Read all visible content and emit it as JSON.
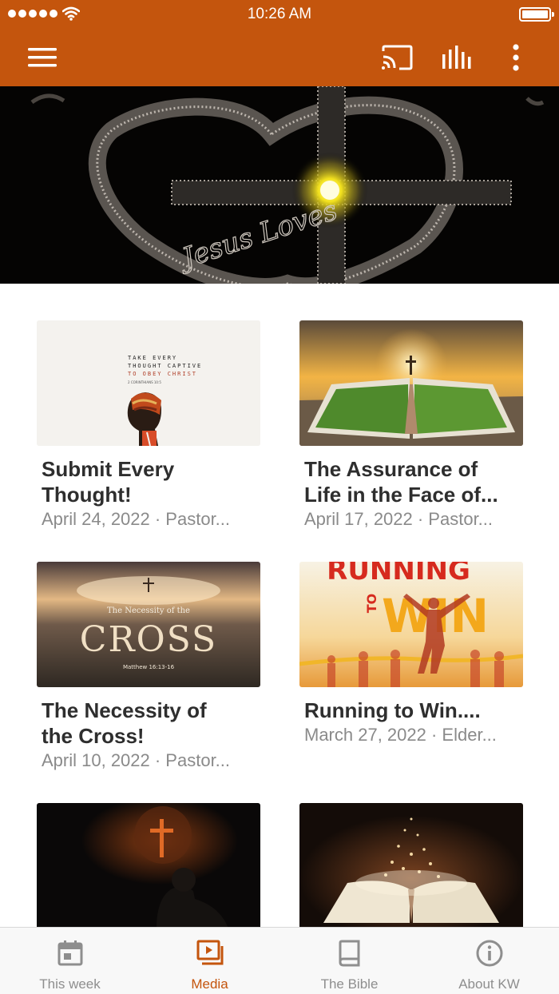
{
  "status_bar": {
    "time": "10:26 AM"
  },
  "app_bar": {
    "menu_icon": "hamburger-menu-icon",
    "actions": [
      "cast-icon",
      "equalizer-icon",
      "more-vertical-icon"
    ],
    "color": "#c4550d"
  },
  "hero": {
    "script_text": "Jesus Loves"
  },
  "media": [
    {
      "title": "Submit Every Thought!",
      "title_lines": [
        "Submit Every",
        "Thought!"
      ],
      "subtitle": "April 24, 2022 · Pastor...",
      "thumb_text": [
        "TAKE EVERY",
        "THOUGHT CAPTIVE",
        "TO OBEY CHRIST",
        "2 CORINTHIANS 10:5"
      ]
    },
    {
      "title": "The Assurance of Life in the Face of...",
      "title_lines": [
        "The Assurance of",
        "Life in the Face of..."
      ],
      "subtitle": "April 17, 2022 · Pastor..."
    },
    {
      "title": "The Necessity of the Cross!",
      "title_lines": [
        "The Necessity of",
        "the Cross!"
      ],
      "subtitle": "April 10, 2022 · Pastor...",
      "thumb_text": [
        "The Necessity of the",
        "CROSS",
        "Matthew 16:13-16"
      ]
    },
    {
      "title": "Running to Win....",
      "title_lines": [
        "Running to Win...."
      ],
      "subtitle": "March 27, 2022 · Elder...",
      "thumb_text": [
        "RUNNING",
        "TO",
        "WIN"
      ]
    },
    {
      "title": "",
      "subtitle": ""
    },
    {
      "title": "",
      "subtitle": ""
    }
  ],
  "tabs": [
    {
      "label": "This week",
      "icon": "calendar-icon",
      "active": false
    },
    {
      "label": "Media",
      "icon": "media-playlist-icon",
      "active": true
    },
    {
      "label": "The Bible",
      "icon": "book-icon",
      "active": false
    },
    {
      "label": "About KW",
      "icon": "info-icon",
      "active": false
    }
  ],
  "colors": {
    "accent": "#c4550d",
    "inactive": "#8e8e8e"
  }
}
